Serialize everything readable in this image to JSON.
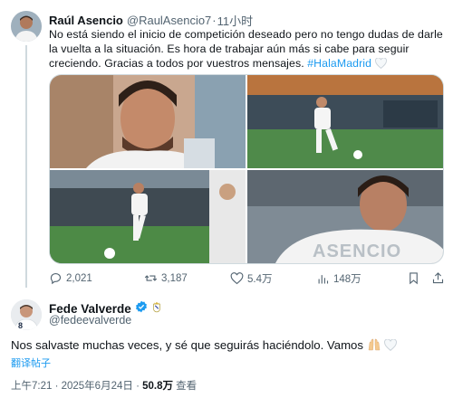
{
  "tweet": {
    "author_name": "Raúl Asencio",
    "author_handle": "@RaulAsencio7",
    "time": "11小时",
    "text": "No está siendo el inicio de competición deseado pero no tengo dudas de darle la vuelta a la situación. Es hora de trabajar aún más si cabe para seguir creciendo. Gracias a todos por vuestros mensajes. ",
    "hashtag": "#HalaMadrid",
    "images": [
      {
        "icon": "player-portrait-photo"
      },
      {
        "icon": "player-training-photo"
      },
      {
        "icon": "player-dribbling-photo"
      },
      {
        "icon": "player-back-asencio-photo",
        "lettering": "ASENCIO"
      }
    ],
    "stats": {
      "replies": "2,021",
      "retweets": "3,187",
      "likes": "5.4万",
      "views": "148万"
    }
  },
  "reply": {
    "author_name": "Fede Valverde",
    "author_handle": "@fedeevalverde",
    "text": "Nos salvaste muchas veces, y sé que seguirás haciéndolo. Vamos ",
    "translate_label": "翻译帖子",
    "timestamp": "上午7:21 · 2025年6月24日 · ",
    "views_count": "50.8万",
    "views_label": " 查看"
  },
  "colors": {
    "accent": "#1d9bf0",
    "secondary_text": "#536471",
    "verified_badge": "#1d9bf0",
    "thread_line": "#cfd9de"
  }
}
